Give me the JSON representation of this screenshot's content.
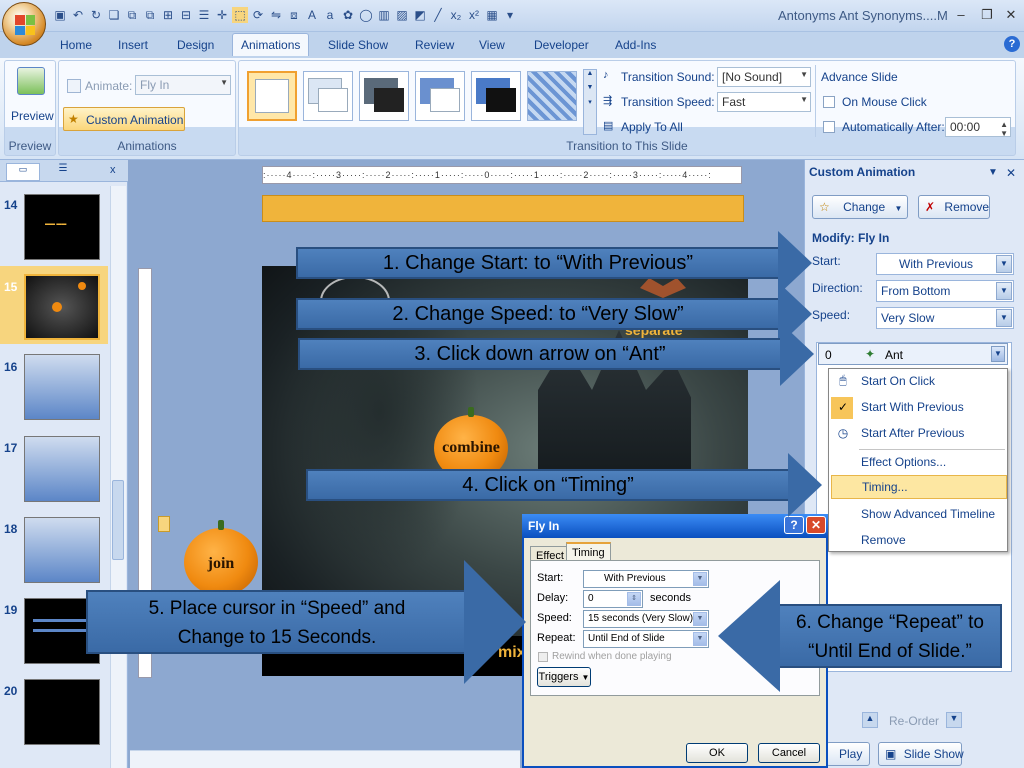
{
  "window": {
    "title": "Antonyms Ant Synonyms....M",
    "minimize": "–",
    "restore": "❐",
    "close": "✕"
  },
  "tabs": [
    "Home",
    "Insert",
    "Design",
    "Animations",
    "Slide Show",
    "Review",
    "View",
    "Developer",
    "Add-Ins"
  ],
  "active_tab": "Animations",
  "ribbon": {
    "preview_group": {
      "button": "Preview",
      "label": "Preview"
    },
    "animations_group": {
      "animate_label": "Animate:",
      "animate_value": "Fly In",
      "custom_animation": "Custom Animation",
      "label": "Animations"
    },
    "transition_group": {
      "sound_label": "Transition Sound:",
      "sound_value": "[No Sound]",
      "speed_label": "Transition Speed:",
      "speed_value": "Fast",
      "apply_all": "Apply To All",
      "advance_title": "Advance Slide",
      "on_mouse_click": "On Mouse Click",
      "auto_after": "Automatically After:",
      "auto_time": "00:00",
      "label": "Transition to This Slide"
    }
  },
  "slides": [
    {
      "num": "14"
    },
    {
      "num": "15"
    },
    {
      "num": "16"
    },
    {
      "num": "17"
    },
    {
      "num": "18"
    },
    {
      "num": "19"
    },
    {
      "num": "20"
    }
  ],
  "slide_content": {
    "separate": "separate",
    "combine": "combine",
    "join": "join",
    "bottom_fragment": "mix"
  },
  "instructions": [
    "1. Change Start: to “With Previous”",
    "2. Change Speed: to “Very Slow”",
    "3. Click down arrow on “Ant”",
    "4. Click on “Timing”",
    "5. Place cursor in “Speed” and",
    "Change to 15 Seconds.",
    "6. Change “Repeat” to",
    "“Until End of Slide.”"
  ],
  "pane": {
    "title": "Custom Animation",
    "change": "Change",
    "remove": "Remove",
    "modify": "Modify: Fly In",
    "start_label": "Start:",
    "start_value": "With Previous",
    "direction_label": "Direction:",
    "direction_value": "From Bottom",
    "speed_label": "Speed:",
    "speed_value": "Very Slow",
    "item_index": "0",
    "item_name": "Ant",
    "reorder": "Re-Order",
    "play": "Play",
    "slide_show": "Slide Show"
  },
  "context_menu": [
    "Start On Click",
    "Start With Previous",
    "Start After Previous",
    "Effect Options...",
    "Timing...",
    "Show Advanced Timeline",
    "Remove"
  ],
  "dialog": {
    "title": "Fly In",
    "tab_effect": "Effect",
    "tab_timing": "Timing",
    "start_label": "Start:",
    "start_value": "With Previous",
    "delay_label": "Delay:",
    "delay_value": "0",
    "delay_unit": "seconds",
    "speed_label": "Speed:",
    "speed_value": "15 seconds (Very Slow)",
    "repeat_label": "Repeat:",
    "repeat_value": "Until End of Slide",
    "rewind": "Rewind when done playing",
    "triggers": "Triggers",
    "ok": "OK",
    "cancel": "Cancel"
  }
}
